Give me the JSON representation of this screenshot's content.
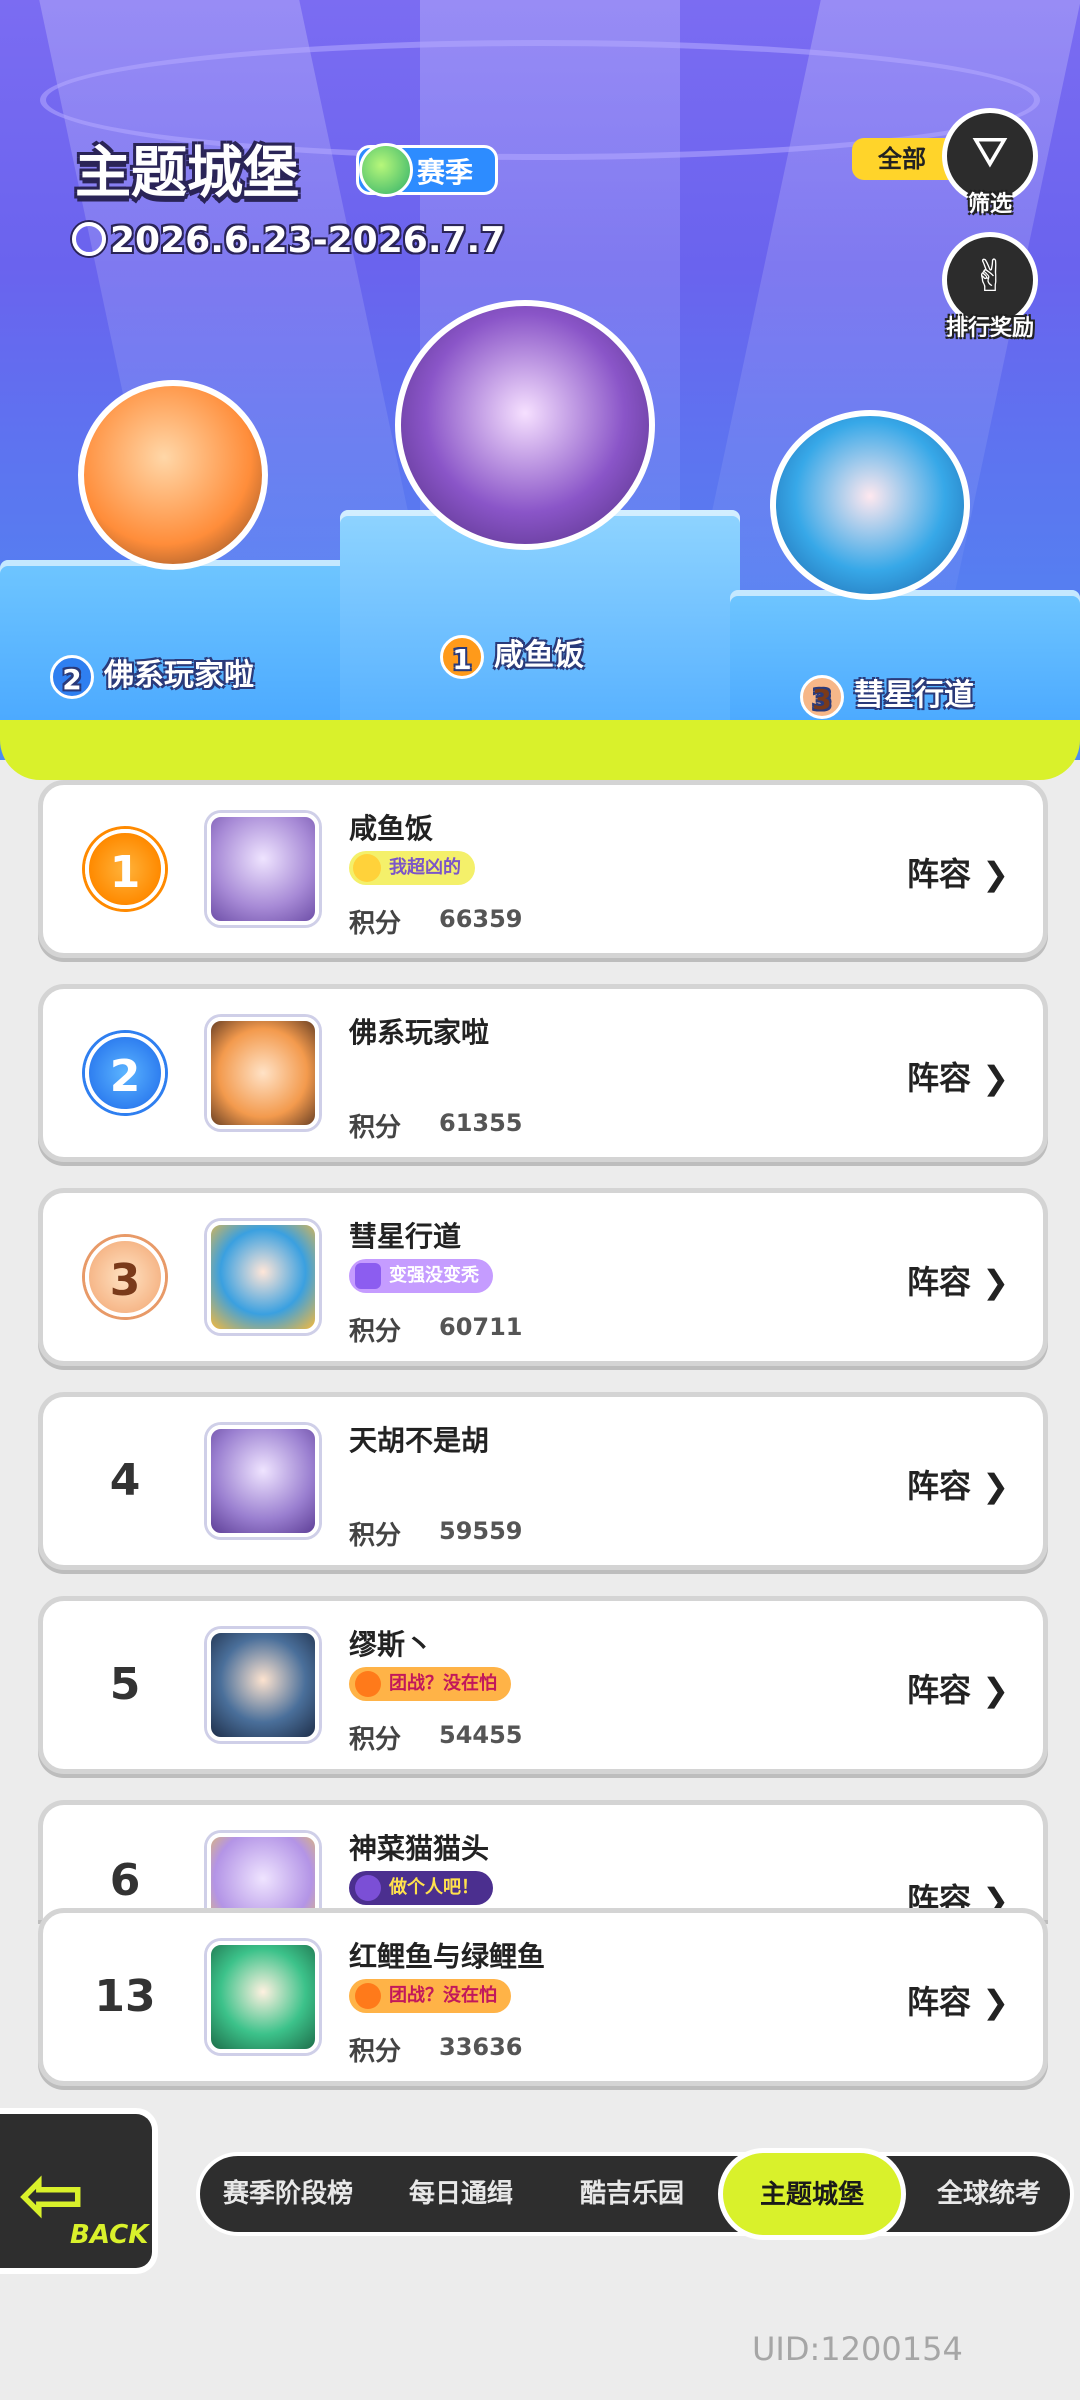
{
  "header": {
    "title": "主题城堡",
    "season_badge": "赛季",
    "date_range": "2026.6.23-2026.7.7",
    "filter_tag": "全部",
    "filter_label": "筛选",
    "reward_label": "排行奖励"
  },
  "podium": [
    {
      "rank": "1",
      "name": "咸鱼饭"
    },
    {
      "rank": "2",
      "name": "佛系玩家啦"
    },
    {
      "rank": "3",
      "name": "彗星行道"
    }
  ],
  "list": {
    "score_label": "积分",
    "lineup_label": "阵容",
    "rows": [
      {
        "rank": "1",
        "name": "咸鱼饭",
        "badge": "我超凶的",
        "score": "66359"
      },
      {
        "rank": "2",
        "name": "佛系玩家啦",
        "badge": "",
        "score": "61355"
      },
      {
        "rank": "3",
        "name": "彗星行道",
        "badge": "变强没变秃",
        "score": "60711"
      },
      {
        "rank": "4",
        "name": "天胡不是胡",
        "badge": "",
        "score": "59559"
      },
      {
        "rank": "5",
        "name": "缪斯丶",
        "badge": "团战？没在怕",
        "score": "54455"
      },
      {
        "rank": "6",
        "name": "神菜猫猫头",
        "badge": "做个人吧！",
        "score": ""
      }
    ],
    "self_row": {
      "rank": "13",
      "name": "红鲤鱼与绿鲤鱼",
      "badge": "团战？没在怕",
      "score": "33636"
    }
  },
  "nav": {
    "back_label": "BACK",
    "tabs": [
      "赛季阶段榜",
      "每日通缉",
      "酷吉乐园",
      "主题城堡",
      "全球统考"
    ],
    "active_tab": "主题城堡"
  },
  "uid": "UID:1200154",
  "colors": {
    "header_purple": "#7b6cf2",
    "accent_lime": "#d9f12b",
    "gold": "#ff8a00",
    "blue": "#2f7ff0",
    "bronze": "#e89a68"
  }
}
